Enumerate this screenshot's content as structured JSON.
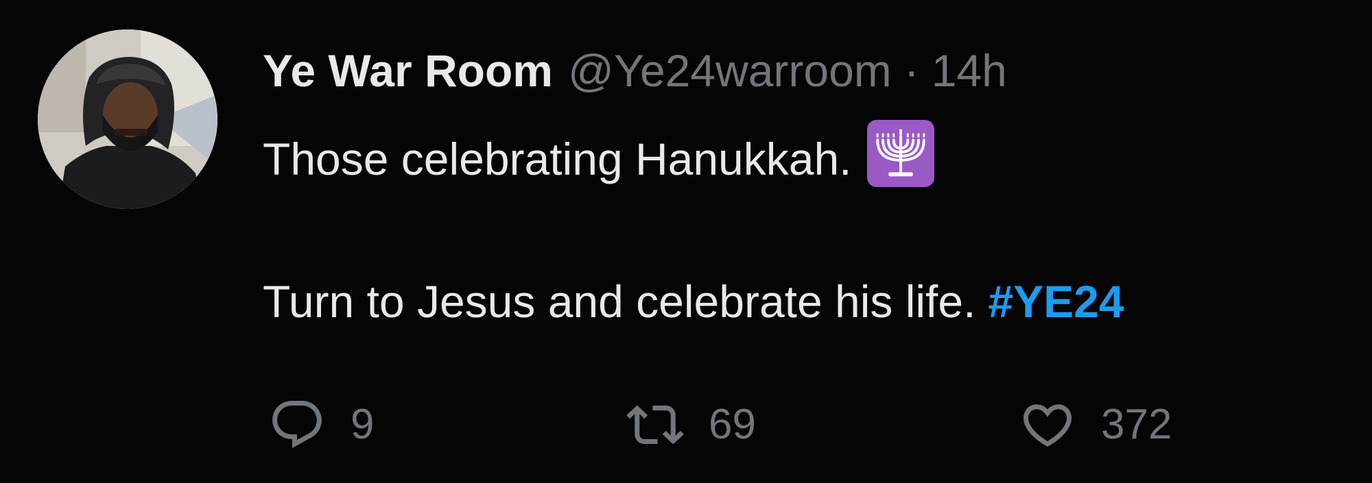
{
  "tweet": {
    "author": {
      "display_name": "Ye War Room",
      "handle": "@Ye24warroom",
      "separator": "·",
      "time": "14h"
    },
    "text": {
      "line1": "Those celebrating Hanukkah.",
      "line1_emoji": "menorah-emoji",
      "line2": "Turn to Jesus and celebrate his life.",
      "hashtag": "#YE24"
    },
    "actions": {
      "reply_count": "9",
      "retweet_count": "69",
      "like_count": "372"
    }
  },
  "colors": {
    "background": "#050505",
    "text": "#e7e9ea",
    "muted": "#71767b",
    "link": "#1d9bf0",
    "emoji_bg": "#9b59c6"
  }
}
